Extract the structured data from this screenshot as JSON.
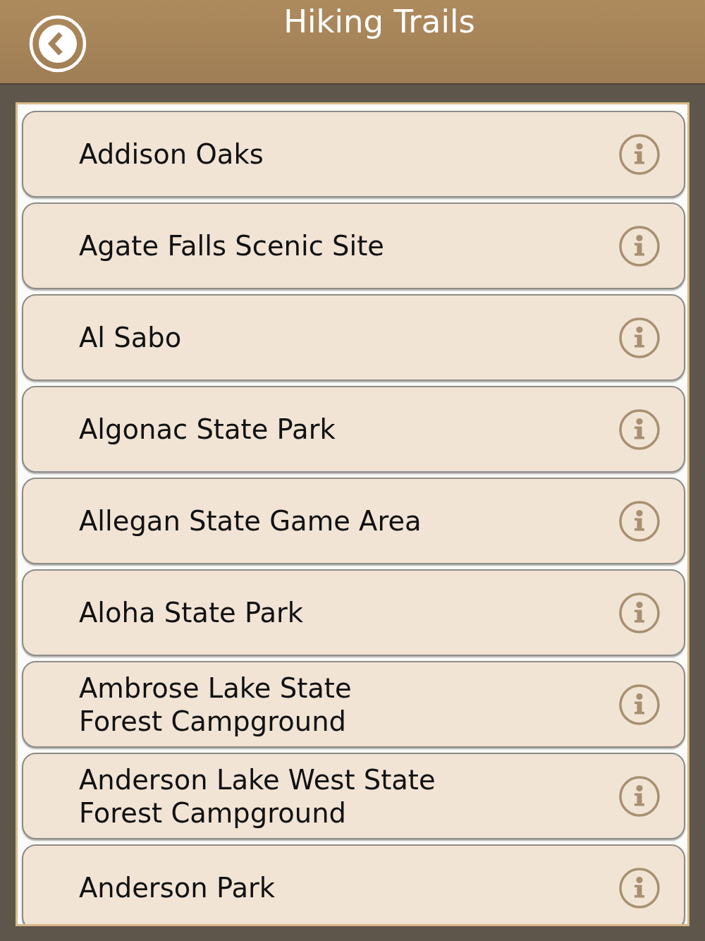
{
  "header": {
    "title": "Hiking Trails"
  },
  "trails": [
    {
      "name": "Addison Oaks"
    },
    {
      "name": "Agate Falls Scenic Site"
    },
    {
      "name": "Al Sabo"
    },
    {
      "name": "Algonac State Park"
    },
    {
      "name": "Allegan State Game Area"
    },
    {
      "name": "Aloha State Park"
    },
    {
      "name": "Ambrose Lake State\nForest Campground"
    },
    {
      "name": "Anderson Lake West State\nForest Campground"
    },
    {
      "name": "Anderson Park"
    }
  ]
}
